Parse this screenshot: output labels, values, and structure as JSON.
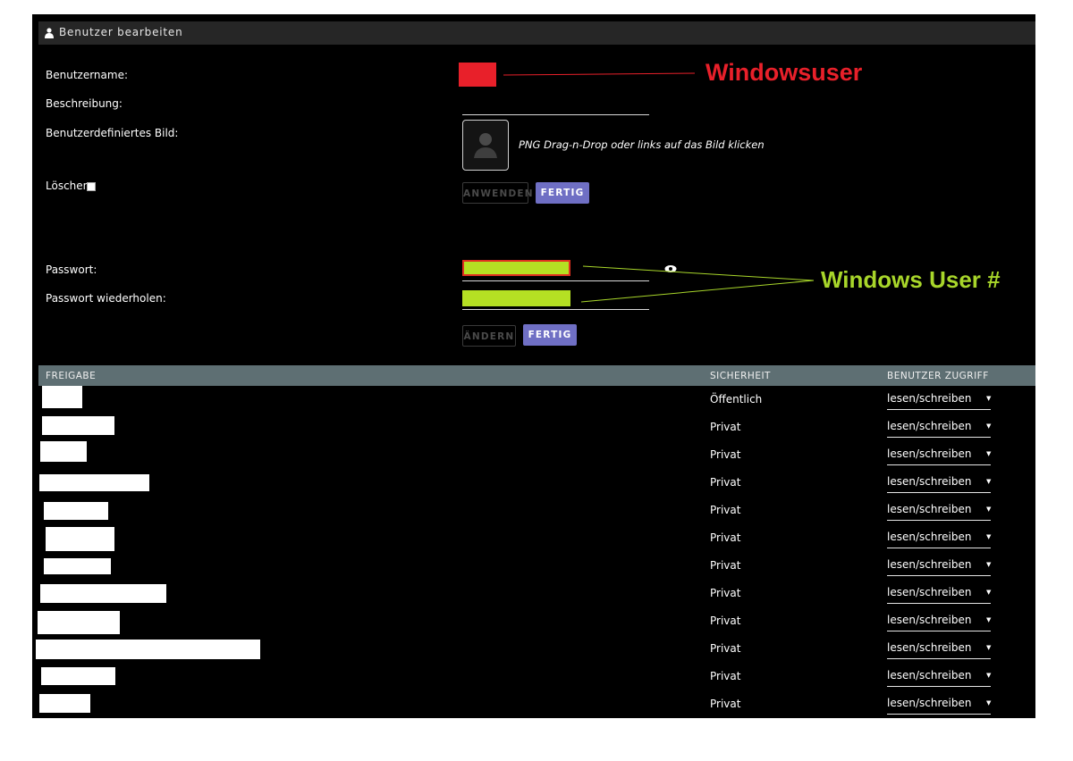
{
  "window": {
    "title": "Benutzer bearbeiten"
  },
  "form": {
    "username_label": "Benutzername:",
    "description_label": "Beschreibung:",
    "custom_image_label": "Benutzerdefiniertes Bild:",
    "image_hint": "PNG Drag-n-Drop oder links auf das Bild klicken",
    "delete_label": "Löschen",
    "apply_button": "ANWENDEN",
    "done_button": "FERTIG",
    "password_label": "Passwort:",
    "password_repeat_label": "Passwort wiederholen:",
    "change_button": "ÄNDERN",
    "done_button_2": "FERTIG"
  },
  "annotations": {
    "username_note": "Windowsuser",
    "password_note": "Windows User #",
    "username_color": "#e8202a",
    "password_color": "#a8d62a"
  },
  "table": {
    "headers": [
      "FREIGABE",
      "SICHERHEIT",
      "BENUTZER ZUGRIFF"
    ],
    "rows": [
      {
        "security": "Öffentlich",
        "access": "lesen/schreiben"
      },
      {
        "security": "Privat",
        "access": "lesen/schreiben"
      },
      {
        "security": "Privat",
        "access": "lesen/schreiben"
      },
      {
        "security": "Privat",
        "access": "lesen/schreiben"
      },
      {
        "security": "Privat",
        "access": "lesen/schreiben"
      },
      {
        "security": "Privat",
        "access": "lesen/schreiben"
      },
      {
        "security": "Privat",
        "access": "lesen/schreiben"
      },
      {
        "security": "Privat",
        "access": "lesen/schreiben"
      },
      {
        "security": "Privat",
        "access": "lesen/schreiben"
      },
      {
        "security": "Privat",
        "access": "lesen/schreiben"
      },
      {
        "security": "Privat",
        "access": "lesen/schreiben"
      },
      {
        "security": "Privat",
        "access": "lesen/schreiben"
      }
    ]
  },
  "colors": {
    "primary_button": "#6f6fc4",
    "table_header": "#5e6f73",
    "password_fill": "#b5e023"
  }
}
